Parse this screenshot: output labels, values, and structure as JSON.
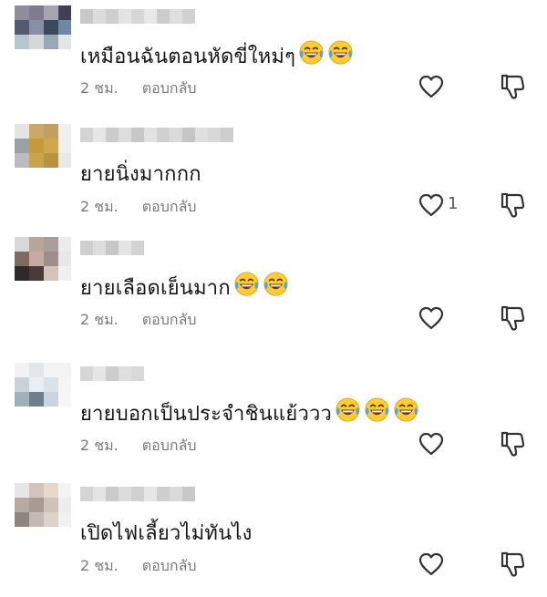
{
  "comments": [
    {
      "text": "เหมือนฉันตอนหัดขี่ใหม่ๆ",
      "emoji_count": 2,
      "time": "2 ชม.",
      "reply_label": "ตอบกลับ",
      "like_count": "",
      "avatar_colors": [
        "#8f8d9b",
        "#7d7a92",
        "#a9a4b4",
        "#3f3f55",
        "#555a72",
        "#8a8fa6",
        "#3b4a5a",
        "#6f8aa0",
        "#b8c4cf",
        "#d4d8dd",
        "#9aa7b4",
        "#e2e6ea"
      ],
      "name_colors": [
        "#c9c9c9",
        "#dcdcdc",
        "#cfcfcf",
        "#e3e3e3",
        "#d6d6d6",
        "#e8e8e8",
        "#cccccc",
        "#dedede",
        "#d2d2d2"
      ]
    },
    {
      "text": "ยายนิ่งมากกก",
      "emoji_count": 0,
      "time": "2 ชม.",
      "reply_label": "ตอบกลับ",
      "like_count": "1",
      "avatar_colors": [
        "#e4e4e4",
        "#caa86a",
        "#c4a060",
        "#f0f0f0",
        "#9aa0a8",
        "#c59a3b",
        "#d1a74e",
        "#efefef",
        "#b9bcc2",
        "#caa44c",
        "#b99340",
        "#e8e8e8"
      ],
      "name_colors": [
        "#d4d4d4",
        "#e6e6e6",
        "#cccccc",
        "#dddddd",
        "#c8c8c8",
        "#e2e2e2",
        "#d0d0d0",
        "#dadada",
        "#c6c6c6",
        "#e0e0e0",
        "#d8d8d8",
        "#cecece"
      ]
    },
    {
      "text": "ยายเลือดเย็นมาก",
      "emoji_count": 2,
      "time": "2 ชม.",
      "reply_label": "ตอบกลับ",
      "like_count": "",
      "avatar_colors": [
        "#d9d9d9",
        "#b7a59c",
        "#a99e9a",
        "#ececec",
        "#7e6a64",
        "#c8aaa2",
        "#9f8e89",
        "#e7e7e7",
        "#2e2a2a",
        "#4a3b38",
        "#d4c3bd",
        "#f0f0f0"
      ],
      "name_colors": [
        "#cfcfcf",
        "#dddddd",
        "#c7c7c7",
        "#e4e4e4",
        "#d3d3d3"
      ]
    },
    {
      "text": "ยายบอกเป็นประจำชินแย้ววว",
      "emoji_count": 3,
      "time": "2 ชม.",
      "reply_label": "ตอบกลับ",
      "like_count": "",
      "avatar_colors": [
        "#f2f2f2",
        "#dfe6ec",
        "#f4f4f4",
        "#f3f3f3",
        "#c7d3dc",
        "#e8eef2",
        "#dbe3ea",
        "#f5f5f5",
        "#9fb0bd",
        "#6c7f8c",
        "#c9d4dc",
        "#f6f6f6"
      ],
      "name_colors": [
        "#d6d6d6",
        "#e5e5e5",
        "#cdcdcd",
        "#dfdfdf",
        "#d9d9d9"
      ]
    },
    {
      "text": "เปิดไฟเลี้ยวไม่ทันไง",
      "emoji_count": 0,
      "time": "2 ชม.",
      "reply_label": "ตอบกลับ",
      "like_count": "",
      "avatar_colors": [
        "#e6e6e6",
        "#d2c4bc",
        "#e9d7cc",
        "#f4f4f4",
        "#b6aaa2",
        "#a89b93",
        "#cfc2b9",
        "#ededed",
        "#8f857f",
        "#c5bab3",
        "#ddd2ca",
        "#f1f1f1"
      ],
      "name_colors": [
        "#d4d4d4",
        "#e4e4e4",
        "#cacaca",
        "#dcdcdc",
        "#d0d0d0",
        "#e6e6e6",
        "#cfcfcf",
        "#dadada",
        "#c8c8c8"
      ]
    }
  ]
}
